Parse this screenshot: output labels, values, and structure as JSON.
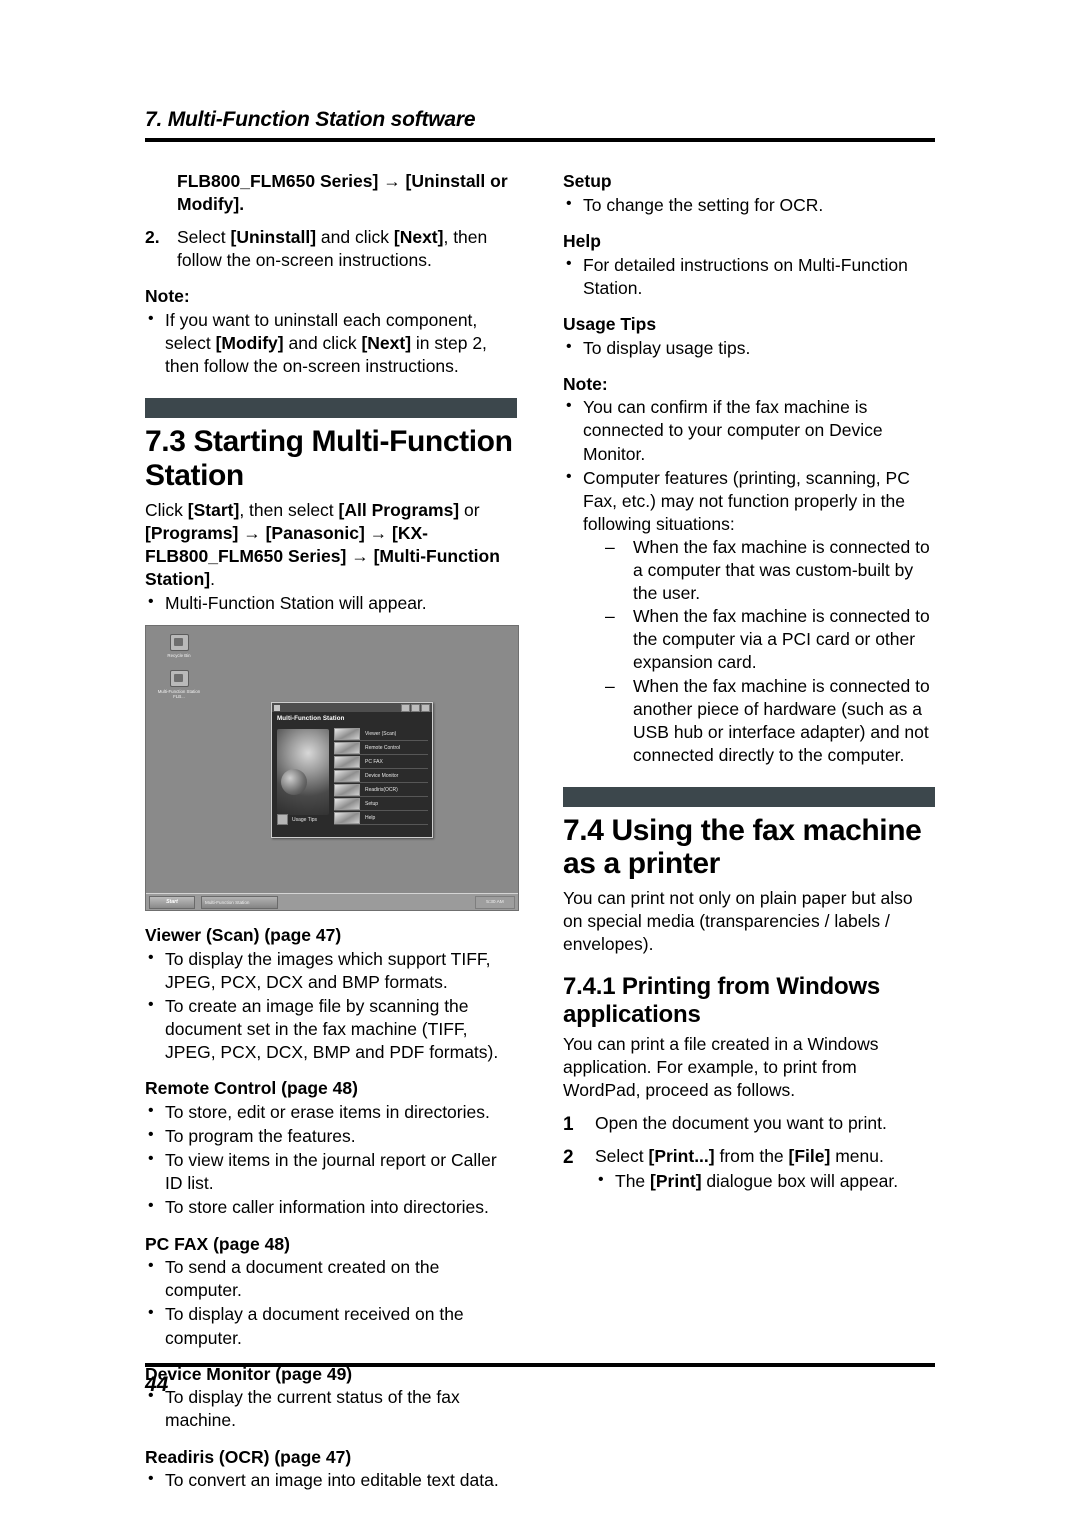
{
  "header": {
    "chapter_title": "7. Multi-Function Station software"
  },
  "footer": {
    "page_number": "44"
  },
  "left_column": {
    "continued_step_text_1": "FLB800_FLM650 Series] → [Uninstall or",
    "continued_step_text_2": "Modify].",
    "step2_number": "2.",
    "step2_text": "Select [Uninstall] and click [Next], then follow the on-screen instructions.",
    "note_label": "Note:",
    "note_bullet": "If you want to uninstall each component, select [Modify] and click [Next] in step 2, then follow the on-screen instructions.",
    "section_heading": "7.3 Starting Multi-Function Station",
    "section_body_1": "Click [Start], then select [All Programs] or",
    "section_body_2": "[Programs] → [Panasonic] → [KX-FLB800_FLM650 Series] → [Multi-Function Station].",
    "section_body_bullet": "Multi-Function Station will appear.",
    "features": [
      {
        "title": "Viewer (Scan) (page 47)",
        "bullets": [
          "To display the images which support TIFF, JPEG, PCX, DCX and BMP formats.",
          "To create an image file by scanning the document set in the fax machine (TIFF, JPEG, PCX, DCX, BMP and PDF formats)."
        ]
      },
      {
        "title": "Remote Control (page 48)",
        "bullets": [
          "To store, edit or erase items in directories.",
          "To program the features.",
          "To view items in the journal report or Caller ID list.",
          "To store caller information into directories."
        ]
      },
      {
        "title": "PC FAX (page 48)",
        "bullets": [
          "To send a document created on the computer.",
          "To display a document received on the computer."
        ]
      },
      {
        "title": "Device Monitor (page 49)",
        "bullets": [
          "To display the current status of the fax machine."
        ]
      },
      {
        "title": "Readiris (OCR) (page 47)",
        "bullets": [
          "To convert an image into editable text data."
        ]
      }
    ]
  },
  "screenshot": {
    "desktop_icons": [
      {
        "label": "Recycle Bin"
      },
      {
        "label": "Multi-Function Station FLB..."
      }
    ],
    "window": {
      "brand": "Multi-Function Station",
      "menu_items": [
        "Viewer (Scan)",
        "Remote Control",
        "PC FAX",
        "Device Monitor",
        "Readiris(OCR)",
        "Setup",
        "Help"
      ],
      "usage_tips_label": "Usage Tips"
    },
    "taskbar": {
      "start_label": "Start",
      "task_label": "Multi-Function Station",
      "clock": "5:30 AM"
    }
  },
  "right_column": {
    "features": [
      {
        "title": "Setup",
        "bullets": [
          "To change the setting for OCR."
        ]
      },
      {
        "title": "Help",
        "bullets": [
          "For detailed instructions on Multi-Function Station."
        ]
      },
      {
        "title": "Usage Tips",
        "bullets": [
          "To display usage tips."
        ]
      }
    ],
    "note_label": "Note:",
    "note_bullet_1": "You can confirm if the fax machine is connected to your computer on Device Monitor.",
    "note_bullet_2": "Computer features (printing, scanning, PC Fax, etc.) may not function properly in the following situations:",
    "note_sub_items": [
      "When the fax machine is connected to a computer that was custom-built by the user.",
      "When the fax machine is connected to the computer via a PCI card or other expansion card.",
      "When the fax machine is connected to another piece of hardware (such as a USB hub or interface adapter) and not connected directly to the computer."
    ],
    "section_heading": "7.4 Using the fax machine as a printer",
    "section_body": "You can print not only on plain paper but also on special media (transparencies / labels / envelopes).",
    "subsection_heading": "7.4.1 Printing from Windows applications",
    "subsection_body": "You can print a file created in a Windows application. For example, to print from WordPad, proceed as follows.",
    "step1_number": "1",
    "step1_text": "Open the document you want to print.",
    "step2_number": "2",
    "step2_text": "Select [Print...] from the [File] menu.",
    "step2_bullet": "The [Print] dialogue box will appear."
  },
  "colors": {
    "banner": "#3c474c",
    "rule": "#000000"
  }
}
